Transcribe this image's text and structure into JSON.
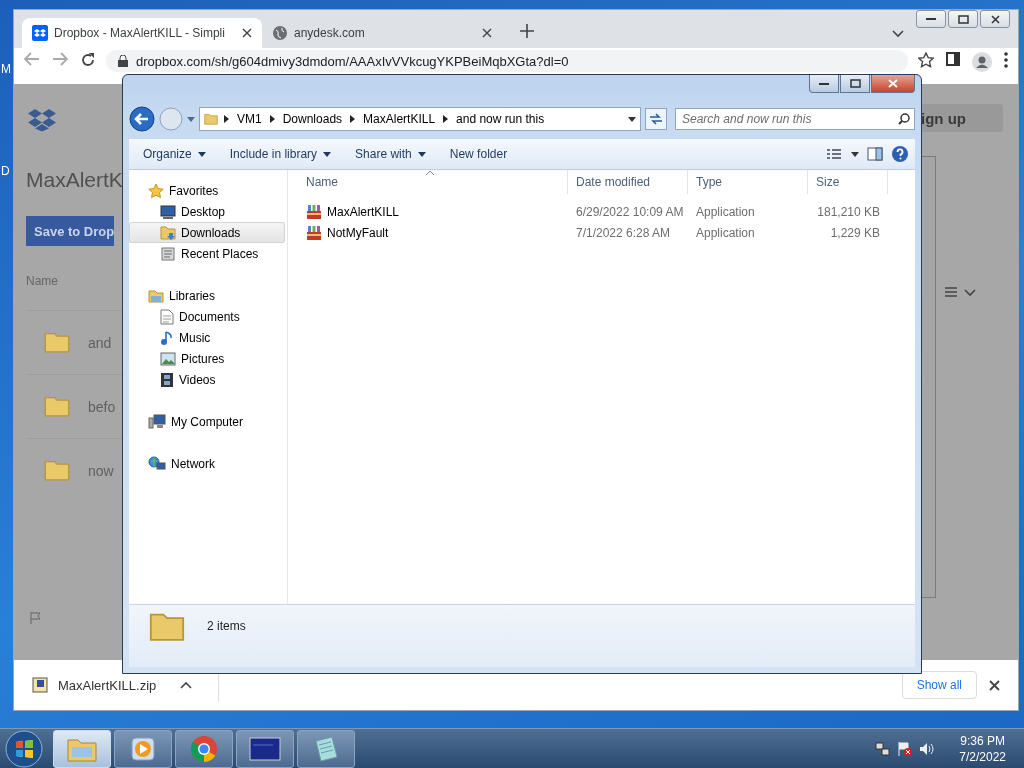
{
  "desktop": {
    "icon_labels": [
      "M",
      "D"
    ]
  },
  "browser": {
    "tabs": [
      {
        "title": "Dropbox - MaxAlertKILL - Simpli",
        "selected": true
      },
      {
        "title": "anydesk.com",
        "selected": false
      }
    ],
    "address": "dropbox.com/sh/g604dmivy3dmdom/AAAxIvVVkcugYKPBeiMqbXGta?dl=0",
    "page": {
      "title": "MaxAlertK",
      "save_button": "Save to Drop",
      "column_header": "Name",
      "rows": [
        "and",
        "befo",
        "now"
      ],
      "sign_up": "ign up"
    },
    "downloads": {
      "file": "MaxAlertKILL.zip",
      "show_all": "Show all"
    }
  },
  "explorer": {
    "breadcrumb": [
      "VM1",
      "Downloads",
      "MaxAlertKILL",
      "and now run this"
    ],
    "search_placeholder": "Search and now run this",
    "commands": [
      {
        "label": "Organize",
        "dropdown": true
      },
      {
        "label": "Include in library",
        "dropdown": true
      },
      {
        "label": "Share with",
        "dropdown": true
      },
      {
        "label": "New folder",
        "dropdown": false
      }
    ],
    "nav": [
      {
        "label": "Favorites",
        "kind": "star",
        "selected": false,
        "children": [
          {
            "label": "Desktop",
            "kind": "desktop",
            "selected": false
          },
          {
            "label": "Downloads",
            "kind": "downloads",
            "selected": true
          },
          {
            "label": "Recent Places",
            "kind": "recent",
            "selected": false
          }
        ]
      },
      {
        "label": "Libraries",
        "kind": "library",
        "selected": false,
        "children": [
          {
            "label": "Documents",
            "kind": "document",
            "selected": false
          },
          {
            "label": "Music",
            "kind": "music",
            "selected": false
          },
          {
            "label": "Pictures",
            "kind": "pictures",
            "selected": false
          },
          {
            "label": "Videos",
            "kind": "videos",
            "selected": false
          }
        ]
      },
      {
        "label": "My Computer",
        "kind": "computer",
        "selected": false
      },
      {
        "label": "Network",
        "kind": "network",
        "selected": false
      }
    ],
    "columns": [
      "Name",
      "Date modified",
      "Type",
      "Size"
    ],
    "files": [
      {
        "name": "MaxAlertKILL",
        "date": "6/29/2022 10:09 AM",
        "type": "Application",
        "size": "181,210 KB"
      },
      {
        "name": "NotMyFault",
        "date": "7/1/2022 6:28 AM",
        "type": "Application",
        "size": "1,229 KB"
      }
    ],
    "status": "2 items"
  },
  "taskbar": {
    "buttons": [
      {
        "kind": "explorer",
        "selected": true
      },
      {
        "kind": "media",
        "selected": false
      },
      {
        "kind": "chrome",
        "selected": false
      },
      {
        "kind": "screen",
        "selected": false
      },
      {
        "kind": "notepad",
        "selected": false
      }
    ],
    "time": "9:36 PM",
    "date": "7/2/2022"
  }
}
